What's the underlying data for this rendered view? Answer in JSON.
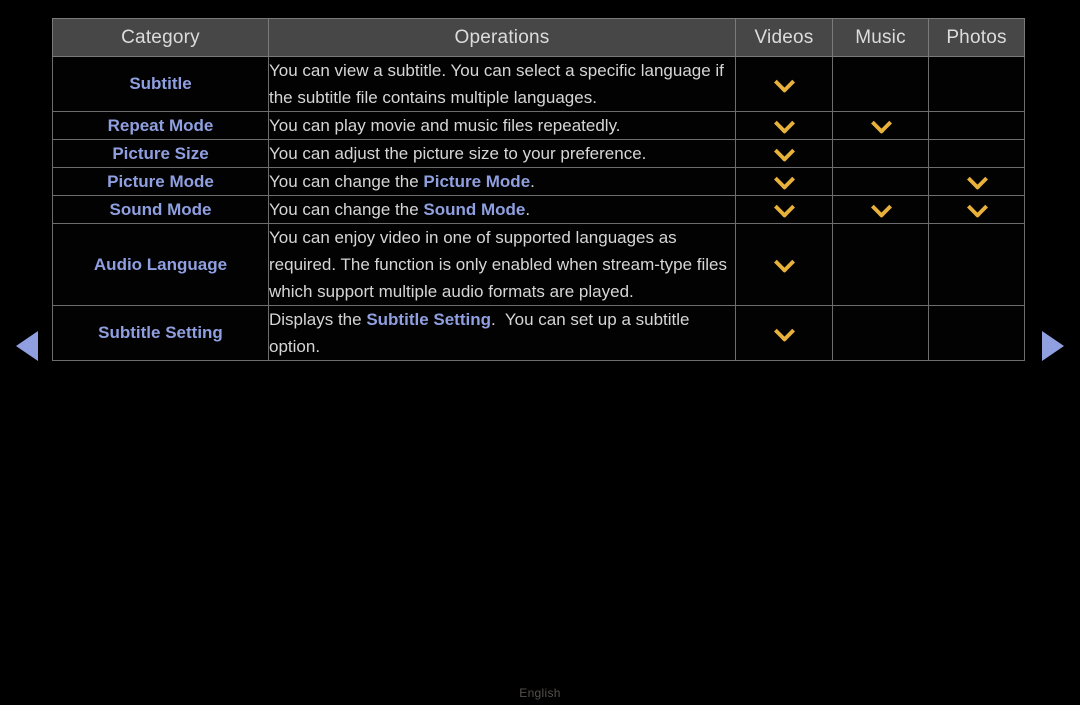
{
  "screen": {
    "background": "#000000",
    "accent_blue": "#8f9fe0",
    "accent_amber": "#e8b13c",
    "header_bg": "#474747"
  },
  "nav": {
    "prev_label": "Previous page",
    "next_label": "Next page",
    "prev_icon": "triangle-left-icon",
    "next_icon": "triangle-right-icon"
  },
  "table": {
    "columns": [
      {
        "key": "category",
        "label": "Category"
      },
      {
        "key": "operations",
        "label": "Operations"
      },
      {
        "key": "videos",
        "label": "Videos"
      },
      {
        "key": "music",
        "label": "Music"
      },
      {
        "key": "photos",
        "label": "Photos"
      }
    ],
    "rows": [
      {
        "category": "Subtitle",
        "operations_plain": "You can view a subtitle. You can select a specific language if the subtitle file contains multiple languages.",
        "operations_html": "You can view a subtitle. You can select a specific language if the subtitle file contains multiple languages.",
        "videos": true,
        "music": false,
        "photos": false
      },
      {
        "category": "Repeat Mode",
        "operations_plain": "You can play movie and music files repeatedly.",
        "operations_html": "You can play movie and music files repeatedly.",
        "videos": true,
        "music": true,
        "photos": false
      },
      {
        "category": "Picture Size",
        "operations_plain": "You can adjust the picture size to your preference.",
        "operations_html": "You can adjust the picture size to your preference.",
        "videos": true,
        "music": false,
        "photos": false
      },
      {
        "category": "Picture Mode",
        "operations_plain": "You can change the Picture Mode.",
        "operations_html": "You can change the <b>Picture Mode</b>.",
        "videos": true,
        "music": false,
        "photos": true
      },
      {
        "category": "Sound Mode",
        "operations_plain": "You can change the Sound Mode.",
        "operations_html": "You can change the <b>Sound Mode</b>.",
        "videos": true,
        "music": true,
        "photos": true
      },
      {
        "category": "Audio Language",
        "operations_plain": "You can enjoy video in one of supported languages as required. The function is only enabled when stream-type files which support multiple audio formats are played.",
        "operations_html": "You can enjoy video in one of supported languages as required. The function is only enabled when stream-type files which support multiple audio formats are played.",
        "videos": true,
        "music": false,
        "photos": false
      },
      {
        "category": "Subtitle Setting",
        "operations_plain": "Displays the Subtitle Setting.  You can set up a subtitle option.",
        "operations_html": "Displays the <b>Subtitle Setting</b>.&nbsp; You can set up a subtitle option.",
        "videos": true,
        "music": false,
        "photos": false
      }
    ],
    "mark_icon": "chevron-down-icon"
  },
  "footer": {
    "language": "English"
  }
}
